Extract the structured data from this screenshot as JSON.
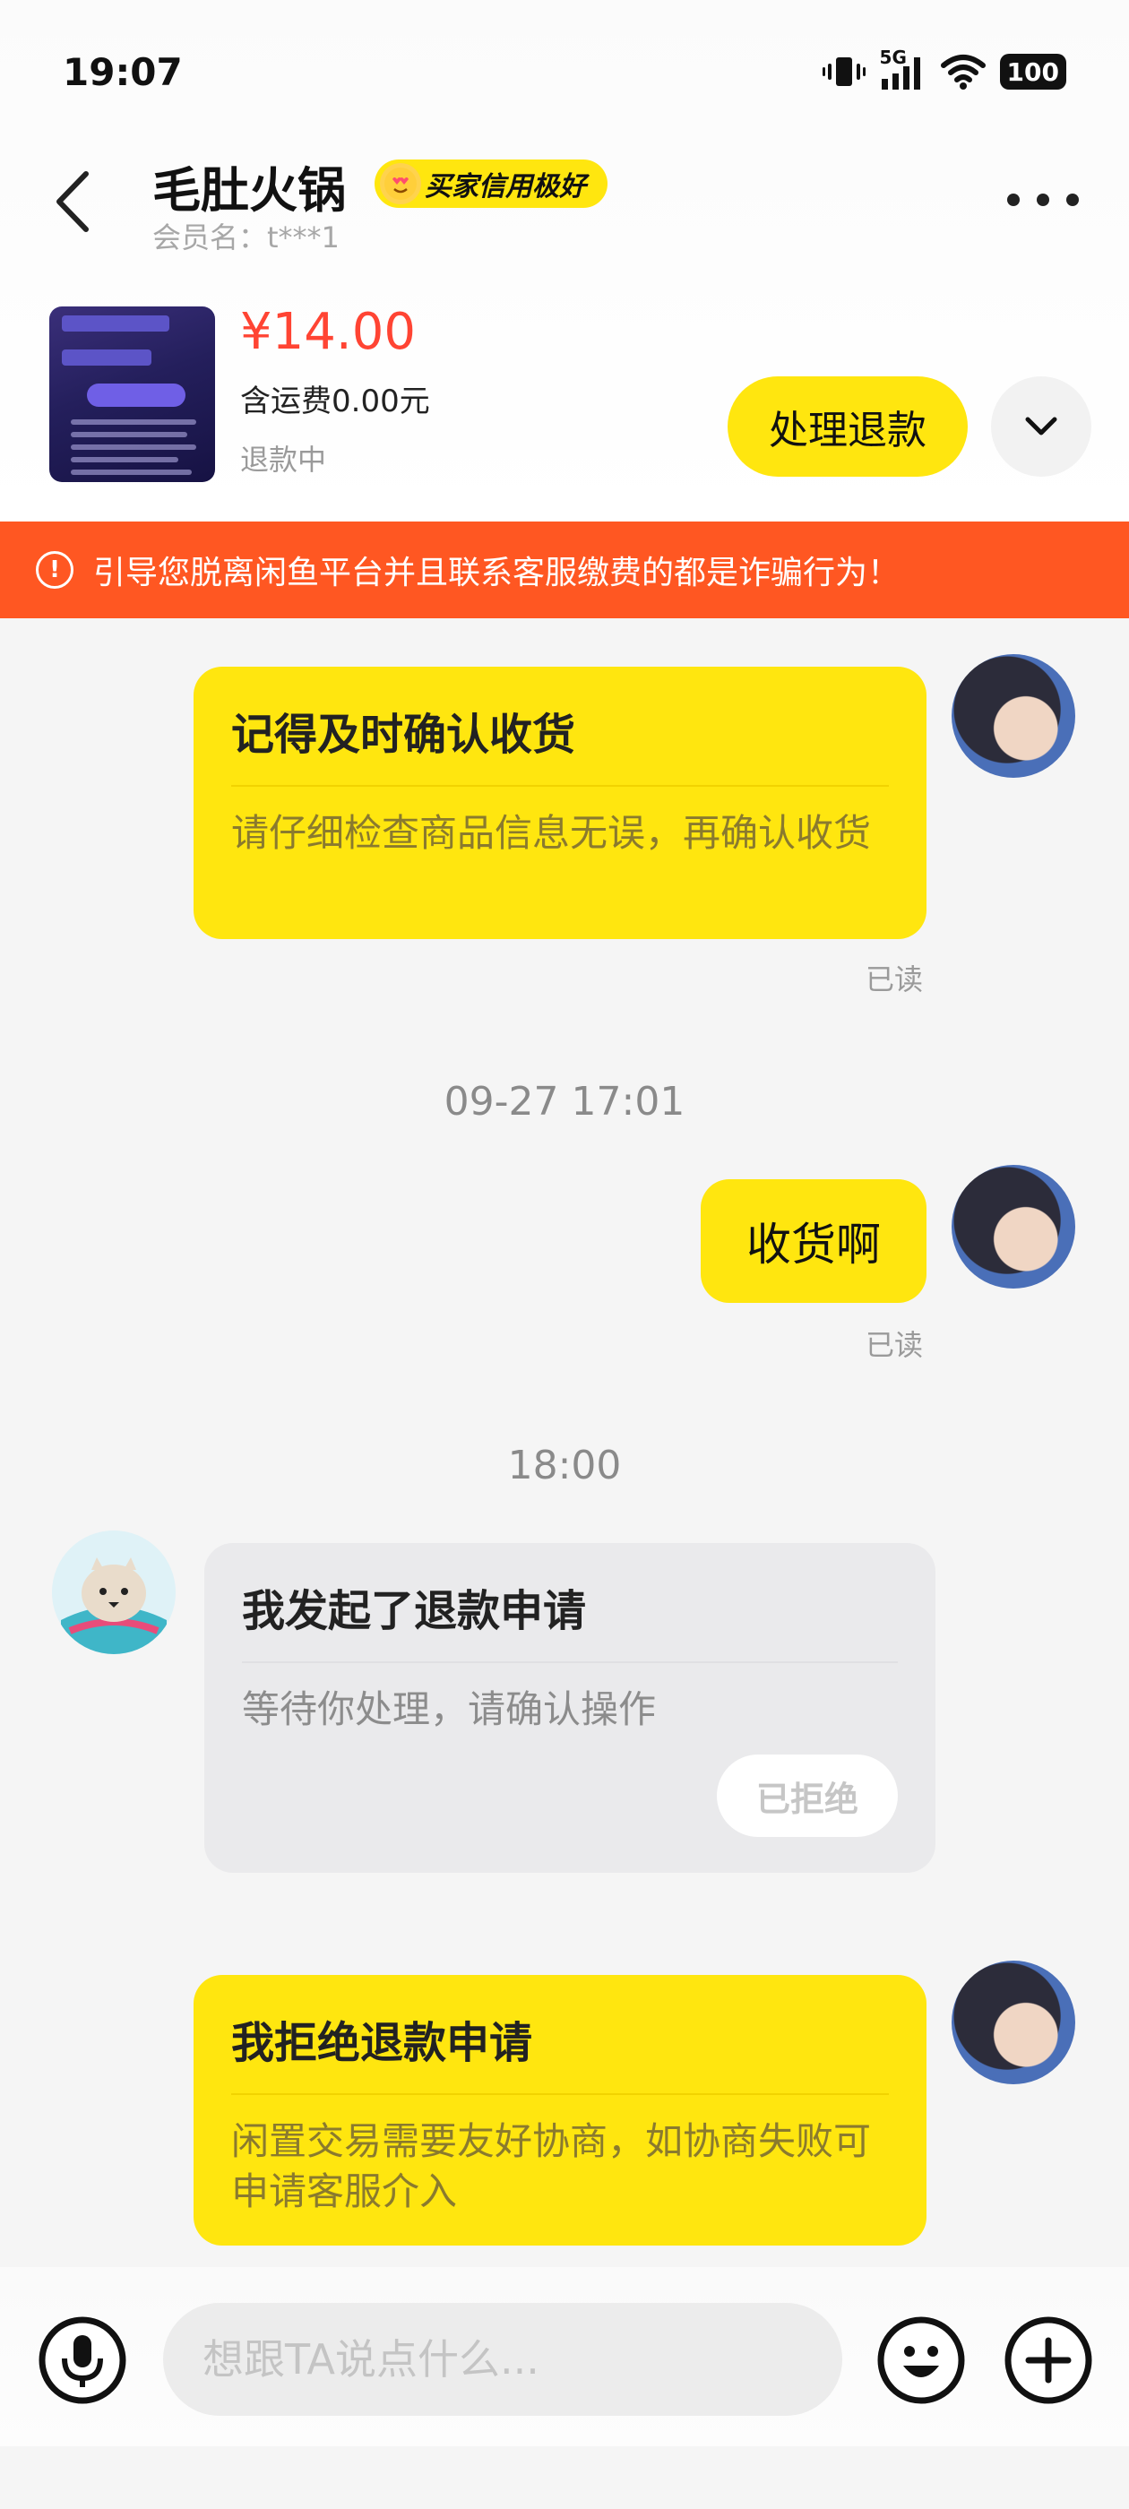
{
  "status_bar": {
    "time": "19:07",
    "network": "5G",
    "battery": "100"
  },
  "header": {
    "title": "毛肚火锅",
    "credit_badge": "买家信用极好",
    "member_label": "会员名：t***1"
  },
  "product": {
    "price": "¥14.00",
    "shipping": "含运费0.00元",
    "status": "退款中",
    "primary_button": "处理退款"
  },
  "warning": {
    "text": "引导您脱离闲鱼平台并且联系客服缴费的都是诈骗行为！"
  },
  "messages": {
    "m1": {
      "title": "记得及时确认收货",
      "desc": "请仔细检查商品信息无误，再确认收货",
      "read": "已读"
    },
    "ts1": "09-27 17:01",
    "m2": {
      "text": "收货啊",
      "read": "已读"
    },
    "ts2": "18:00",
    "m3": {
      "title": "我发起了退款申请",
      "desc": "等待你处理，请确认操作",
      "button": "已拒绝"
    },
    "m4": {
      "title": "我拒绝退款申请",
      "desc": "闲置交易需要友好协商，如协商失败可申请客服介入"
    }
  },
  "input": {
    "placeholder": "想跟TA说点什么..."
  },
  "colors": {
    "accent_yellow": "#ffe60f",
    "warning_orange": "#ff5722",
    "price_red": "#ff4433"
  }
}
